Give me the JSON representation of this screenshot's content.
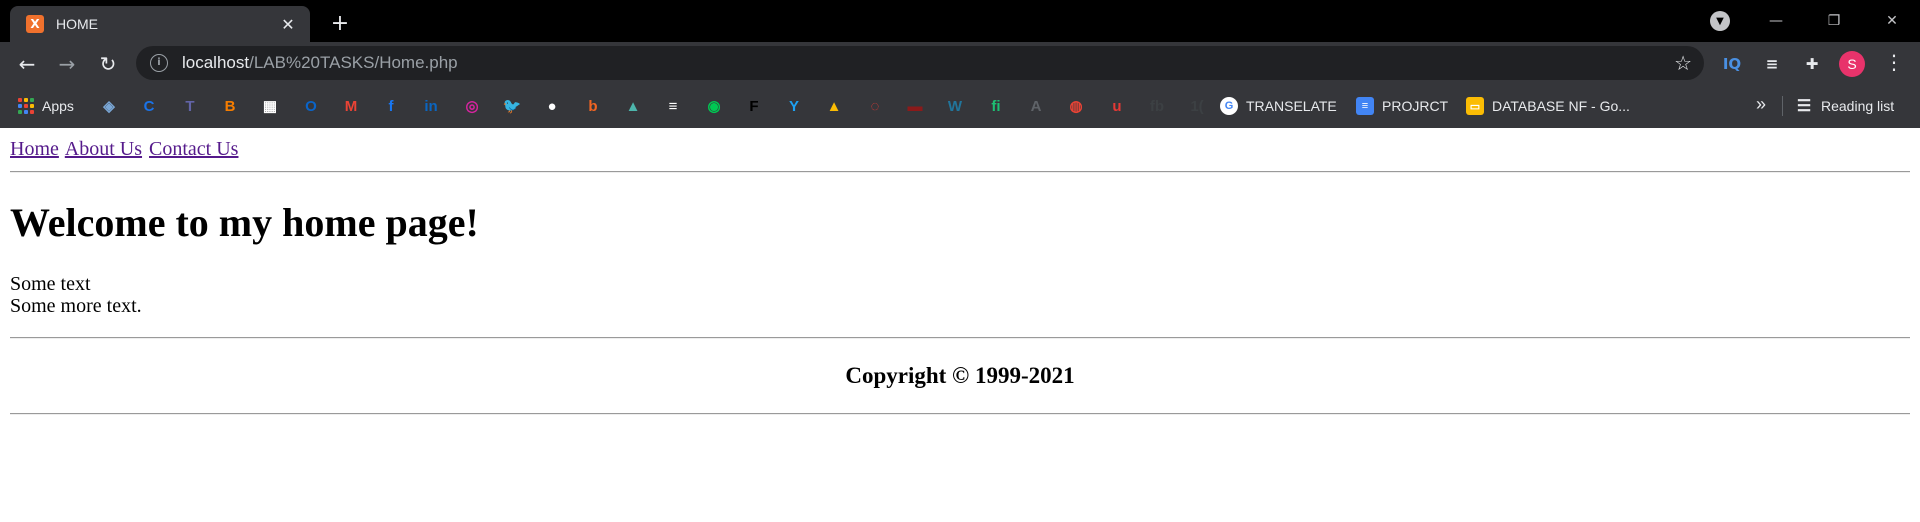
{
  "browser": {
    "tab": {
      "title": "HOME",
      "favicon": "X"
    },
    "omnibox": {
      "host": "localhost",
      "path": "/LAB%20TASKS/Home.php"
    },
    "profile_initial": "S",
    "bookmarks": {
      "apps_label": "Apps",
      "items": [
        {
          "name": "shield",
          "color": "#7aa7d6",
          "glyph": "◈"
        },
        {
          "name": "c",
          "color": "#1a73e8",
          "glyph": "C"
        },
        {
          "name": "teams",
          "color": "#6264a7",
          "glyph": "T"
        },
        {
          "name": "blogger",
          "color": "#f57d00",
          "glyph": "B"
        },
        {
          "name": "photo",
          "color": "#ffffff",
          "glyph": "▦"
        },
        {
          "name": "outlook",
          "color": "#0a64c8",
          "glyph": "O"
        },
        {
          "name": "gmail",
          "color": "#ea4335",
          "glyph": "M"
        },
        {
          "name": "facebook",
          "color": "#1877f2",
          "glyph": "f"
        },
        {
          "name": "linkedin",
          "color": "#0a66c2",
          "glyph": "in"
        },
        {
          "name": "instagram",
          "color": "#d6249f",
          "glyph": "◎"
        },
        {
          "name": "twitter",
          "color": "#1da1f2",
          "glyph": "🐦"
        },
        {
          "name": "github",
          "color": "#ffffff",
          "glyph": "●"
        },
        {
          "name": "b-circle",
          "color": "#f26522",
          "glyph": "b"
        },
        {
          "name": "shapes",
          "color": "#4db6ac",
          "glyph": "▲"
        },
        {
          "name": "stack",
          "color": "#ffffff",
          "glyph": "≡"
        },
        {
          "name": "green-circle",
          "color": "#00c853",
          "glyph": "◉"
        },
        {
          "name": "f-black",
          "color": "#000000",
          "glyph": "F"
        },
        {
          "name": "y-blue",
          "color": "#1da1f2",
          "glyph": "Y"
        },
        {
          "name": "drive",
          "color": "#fbbc04",
          "glyph": "▲"
        },
        {
          "name": "ring",
          "color": "#e53935",
          "glyph": "◌"
        },
        {
          "name": "red-bar",
          "color": "#8b1a1a",
          "glyph": "▬"
        },
        {
          "name": "wordpress",
          "color": "#21759b",
          "glyph": "W"
        },
        {
          "name": "fiverr",
          "color": "#1dbf73",
          "glyph": "fi"
        },
        {
          "name": "translate-a",
          "color": "#5f6368",
          "glyph": "A"
        },
        {
          "name": "chrome",
          "color": "#ea4335",
          "glyph": "◍"
        },
        {
          "name": "u-red",
          "color": "#e53935",
          "glyph": "u"
        },
        {
          "name": "fb-dark",
          "color": "#3c4043",
          "glyph": "fb"
        },
        {
          "name": "tv-dark",
          "color": "#3c4043",
          "glyph": "1("
        }
      ],
      "labeled": [
        {
          "label": "TRANSELATE",
          "color": "#ffffff",
          "glyph": "G"
        },
        {
          "label": "PROJRCT",
          "color": "#4285f4",
          "glyph": "≡"
        },
        {
          "label": "DATABASE NF - Go...",
          "color": "#fbbc04",
          "glyph": "▭"
        }
      ],
      "reading_list": "Reading list"
    }
  },
  "page": {
    "nav": [
      {
        "label": "Home"
      },
      {
        "label": "About Us"
      },
      {
        "label": "Contact Us"
      }
    ],
    "heading": "Welcome to my home page!",
    "lines": [
      "Some text",
      "Some more text."
    ],
    "copyright": "Copyright © 1999-2021"
  }
}
